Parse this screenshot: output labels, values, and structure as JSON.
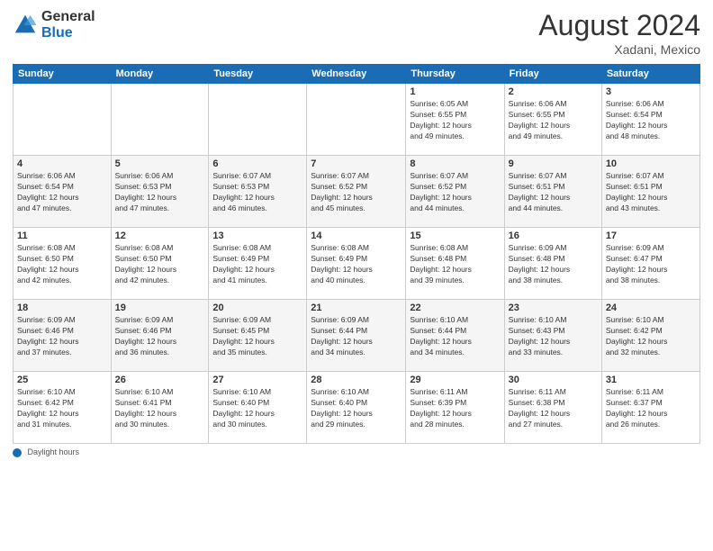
{
  "header": {
    "logo_general": "General",
    "logo_blue": "Blue",
    "month_title": "August 2024",
    "location": "Xadani, Mexico"
  },
  "calendar": {
    "days_of_week": [
      "Sunday",
      "Monday",
      "Tuesday",
      "Wednesday",
      "Thursday",
      "Friday",
      "Saturday"
    ],
    "weeks": [
      [
        {
          "day": "",
          "info": ""
        },
        {
          "day": "",
          "info": ""
        },
        {
          "day": "",
          "info": ""
        },
        {
          "day": "",
          "info": ""
        },
        {
          "day": "1",
          "info": "Sunrise: 6:05 AM\nSunset: 6:55 PM\nDaylight: 12 hours\nand 49 minutes."
        },
        {
          "day": "2",
          "info": "Sunrise: 6:06 AM\nSunset: 6:55 PM\nDaylight: 12 hours\nand 49 minutes."
        },
        {
          "day": "3",
          "info": "Sunrise: 6:06 AM\nSunset: 6:54 PM\nDaylight: 12 hours\nand 48 minutes."
        }
      ],
      [
        {
          "day": "4",
          "info": "Sunrise: 6:06 AM\nSunset: 6:54 PM\nDaylight: 12 hours\nand 47 minutes."
        },
        {
          "day": "5",
          "info": "Sunrise: 6:06 AM\nSunset: 6:53 PM\nDaylight: 12 hours\nand 47 minutes."
        },
        {
          "day": "6",
          "info": "Sunrise: 6:07 AM\nSunset: 6:53 PM\nDaylight: 12 hours\nand 46 minutes."
        },
        {
          "day": "7",
          "info": "Sunrise: 6:07 AM\nSunset: 6:52 PM\nDaylight: 12 hours\nand 45 minutes."
        },
        {
          "day": "8",
          "info": "Sunrise: 6:07 AM\nSunset: 6:52 PM\nDaylight: 12 hours\nand 44 minutes."
        },
        {
          "day": "9",
          "info": "Sunrise: 6:07 AM\nSunset: 6:51 PM\nDaylight: 12 hours\nand 44 minutes."
        },
        {
          "day": "10",
          "info": "Sunrise: 6:07 AM\nSunset: 6:51 PM\nDaylight: 12 hours\nand 43 minutes."
        }
      ],
      [
        {
          "day": "11",
          "info": "Sunrise: 6:08 AM\nSunset: 6:50 PM\nDaylight: 12 hours\nand 42 minutes."
        },
        {
          "day": "12",
          "info": "Sunrise: 6:08 AM\nSunset: 6:50 PM\nDaylight: 12 hours\nand 42 minutes."
        },
        {
          "day": "13",
          "info": "Sunrise: 6:08 AM\nSunset: 6:49 PM\nDaylight: 12 hours\nand 41 minutes."
        },
        {
          "day": "14",
          "info": "Sunrise: 6:08 AM\nSunset: 6:49 PM\nDaylight: 12 hours\nand 40 minutes."
        },
        {
          "day": "15",
          "info": "Sunrise: 6:08 AM\nSunset: 6:48 PM\nDaylight: 12 hours\nand 39 minutes."
        },
        {
          "day": "16",
          "info": "Sunrise: 6:09 AM\nSunset: 6:48 PM\nDaylight: 12 hours\nand 38 minutes."
        },
        {
          "day": "17",
          "info": "Sunrise: 6:09 AM\nSunset: 6:47 PM\nDaylight: 12 hours\nand 38 minutes."
        }
      ],
      [
        {
          "day": "18",
          "info": "Sunrise: 6:09 AM\nSunset: 6:46 PM\nDaylight: 12 hours\nand 37 minutes."
        },
        {
          "day": "19",
          "info": "Sunrise: 6:09 AM\nSunset: 6:46 PM\nDaylight: 12 hours\nand 36 minutes."
        },
        {
          "day": "20",
          "info": "Sunrise: 6:09 AM\nSunset: 6:45 PM\nDaylight: 12 hours\nand 35 minutes."
        },
        {
          "day": "21",
          "info": "Sunrise: 6:09 AM\nSunset: 6:44 PM\nDaylight: 12 hours\nand 34 minutes."
        },
        {
          "day": "22",
          "info": "Sunrise: 6:10 AM\nSunset: 6:44 PM\nDaylight: 12 hours\nand 34 minutes."
        },
        {
          "day": "23",
          "info": "Sunrise: 6:10 AM\nSunset: 6:43 PM\nDaylight: 12 hours\nand 33 minutes."
        },
        {
          "day": "24",
          "info": "Sunrise: 6:10 AM\nSunset: 6:42 PM\nDaylight: 12 hours\nand 32 minutes."
        }
      ],
      [
        {
          "day": "25",
          "info": "Sunrise: 6:10 AM\nSunset: 6:42 PM\nDaylight: 12 hours\nand 31 minutes."
        },
        {
          "day": "26",
          "info": "Sunrise: 6:10 AM\nSunset: 6:41 PM\nDaylight: 12 hours\nand 30 minutes."
        },
        {
          "day": "27",
          "info": "Sunrise: 6:10 AM\nSunset: 6:40 PM\nDaylight: 12 hours\nand 30 minutes."
        },
        {
          "day": "28",
          "info": "Sunrise: 6:10 AM\nSunset: 6:40 PM\nDaylight: 12 hours\nand 29 minutes."
        },
        {
          "day": "29",
          "info": "Sunrise: 6:11 AM\nSunset: 6:39 PM\nDaylight: 12 hours\nand 28 minutes."
        },
        {
          "day": "30",
          "info": "Sunrise: 6:11 AM\nSunset: 6:38 PM\nDaylight: 12 hours\nand 27 minutes."
        },
        {
          "day": "31",
          "info": "Sunrise: 6:11 AM\nSunset: 6:37 PM\nDaylight: 12 hours\nand 26 minutes."
        }
      ]
    ]
  },
  "footer": {
    "daylight_hours_label": "Daylight hours"
  }
}
